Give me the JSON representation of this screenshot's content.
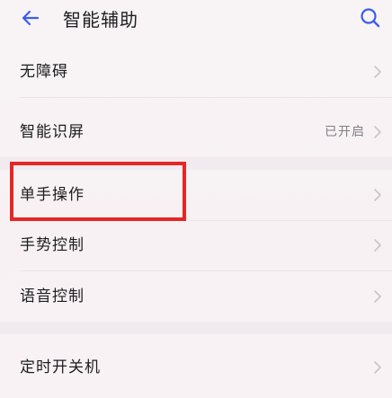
{
  "header": {
    "title": "智能辅助",
    "back_icon": "back-arrow-icon",
    "search_icon": "search-icon",
    "accent_color": "#3b5cf0"
  },
  "list": {
    "items": [
      {
        "label": "无障碍",
        "value": ""
      },
      {
        "label": "智能识屏",
        "value": "已开启"
      },
      {
        "label": "单手操作",
        "value": ""
      },
      {
        "label": "手势控制",
        "value": ""
      },
      {
        "label": "语音控制",
        "value": ""
      },
      {
        "label": "定时开关机",
        "value": ""
      }
    ]
  },
  "annotation": {
    "highlight_color": "#e52626"
  }
}
